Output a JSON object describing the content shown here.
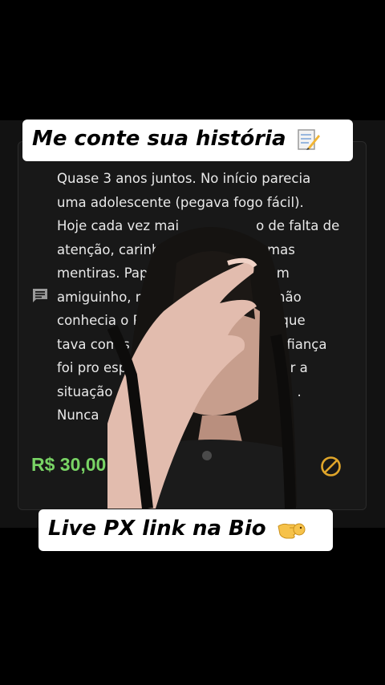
{
  "caption_top": {
    "text": "Me conte sua história",
    "icon": "memo-icon"
  },
  "card": {
    "message_lines": [
      "Quase 3 anos juntos. No início parecia",
      "uma adolescente (pegava fogo fácil).",
      "Hoje cada vez mai",
      "atenção, carinho",
      "mentiras. Papo",
      "amiguinho, me",
      "conhecia o P",
      "tava com s",
      "foi pro esp",
      "situação",
      "Nunca"
    ],
    "message_fragments_right": [
      "",
      "",
      "o de falta de",
      "lgumas",
      "om",
      "não",
      "se que",
      "onfiança",
      "rter a",
      ".",
      ""
    ],
    "price": "R$ 30,00",
    "chat_icon": "chat-bubble-icon",
    "status_icon": "block-icon",
    "accent": "#79d465",
    "status_color": "#e0a62a"
  },
  "caption_bottom": {
    "text": "Live PX link na Bio",
    "icon": "pointing-hand-icon"
  }
}
